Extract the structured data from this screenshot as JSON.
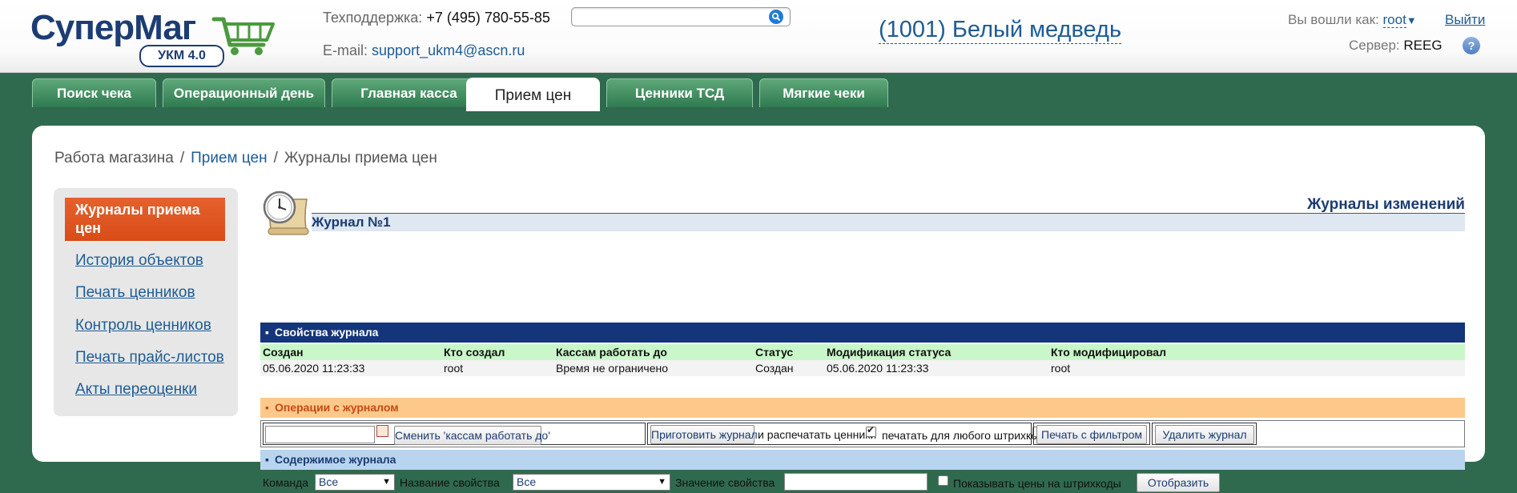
{
  "header": {
    "logo_text_1": "Супер",
    "logo_text_2": "Маг",
    "logo_badge": "УКМ 4.0",
    "support_label": "Техподдержка:",
    "support_phone": "+7 (495) 780-55-85",
    "email_label": "E-mail:",
    "email": "support_ukm4@ascn.ru",
    "search_value": "",
    "store_name": "(1001) Белый медведь",
    "logged_in_label": "Вы вошли как:",
    "user": "root",
    "logout": "Выйти",
    "server_label": "Сервер:",
    "server": "REEG"
  },
  "tabs": [
    {
      "label": "Поиск чека"
    },
    {
      "label": "Операционный день"
    },
    {
      "label": "Главная касса"
    },
    {
      "label": "Прием цен",
      "active": true
    },
    {
      "label": "Ценники ТСД"
    },
    {
      "label": "Мягкие чеки"
    }
  ],
  "breadcrumb": {
    "item1": "Работа магазина",
    "item2": "Прием цен",
    "item3": "Журналы приема цен"
  },
  "sidebar": {
    "active": "Журналы приема цен",
    "items": [
      "История объектов",
      "Печать ценников",
      "Контроль ценников",
      "Печать прайс-листов",
      "Акты переоценки"
    ]
  },
  "content": {
    "changes_title": "Журналы изменений",
    "journal_title": "Журнал №1",
    "props_section": "Свойства журнала",
    "props_columns": [
      "Создан",
      "Кто создал",
      "Кассам работать до",
      "Статус",
      "Модификация статуса",
      "Кто модифицировал"
    ],
    "props_values": [
      "05.06.2020 11:23:33",
      "root",
      "Время не ограничено",
      "Создан",
      "05.06.2020 11:23:33",
      "root"
    ],
    "ops_section": "Операции с журналом",
    "ops": {
      "date_value": "",
      "change_btn": "Сменить 'кассам работать до'",
      "prepare_btn": "Приготовить журнал",
      "print_label": "и распечатать ценники",
      "print_checked": true,
      "any_barcode_label": "печатать для любого штрихкода",
      "any_barcode_checked": false,
      "filter_print_btn": "Печать с фильтром",
      "delete_btn": "Удалить журнал"
    },
    "content_section": "Содержимое журнала",
    "filter": {
      "command_label": "Команда",
      "command_value": "Все",
      "prop_name_label": "Название свойства",
      "prop_name_value": "Все",
      "prop_value_label": "Значение свойства",
      "prop_value": "",
      "show_prices_label": "Показывать цены на штрихкоды",
      "show_prices_checked": false,
      "show_btn": "Отобразить"
    }
  }
}
